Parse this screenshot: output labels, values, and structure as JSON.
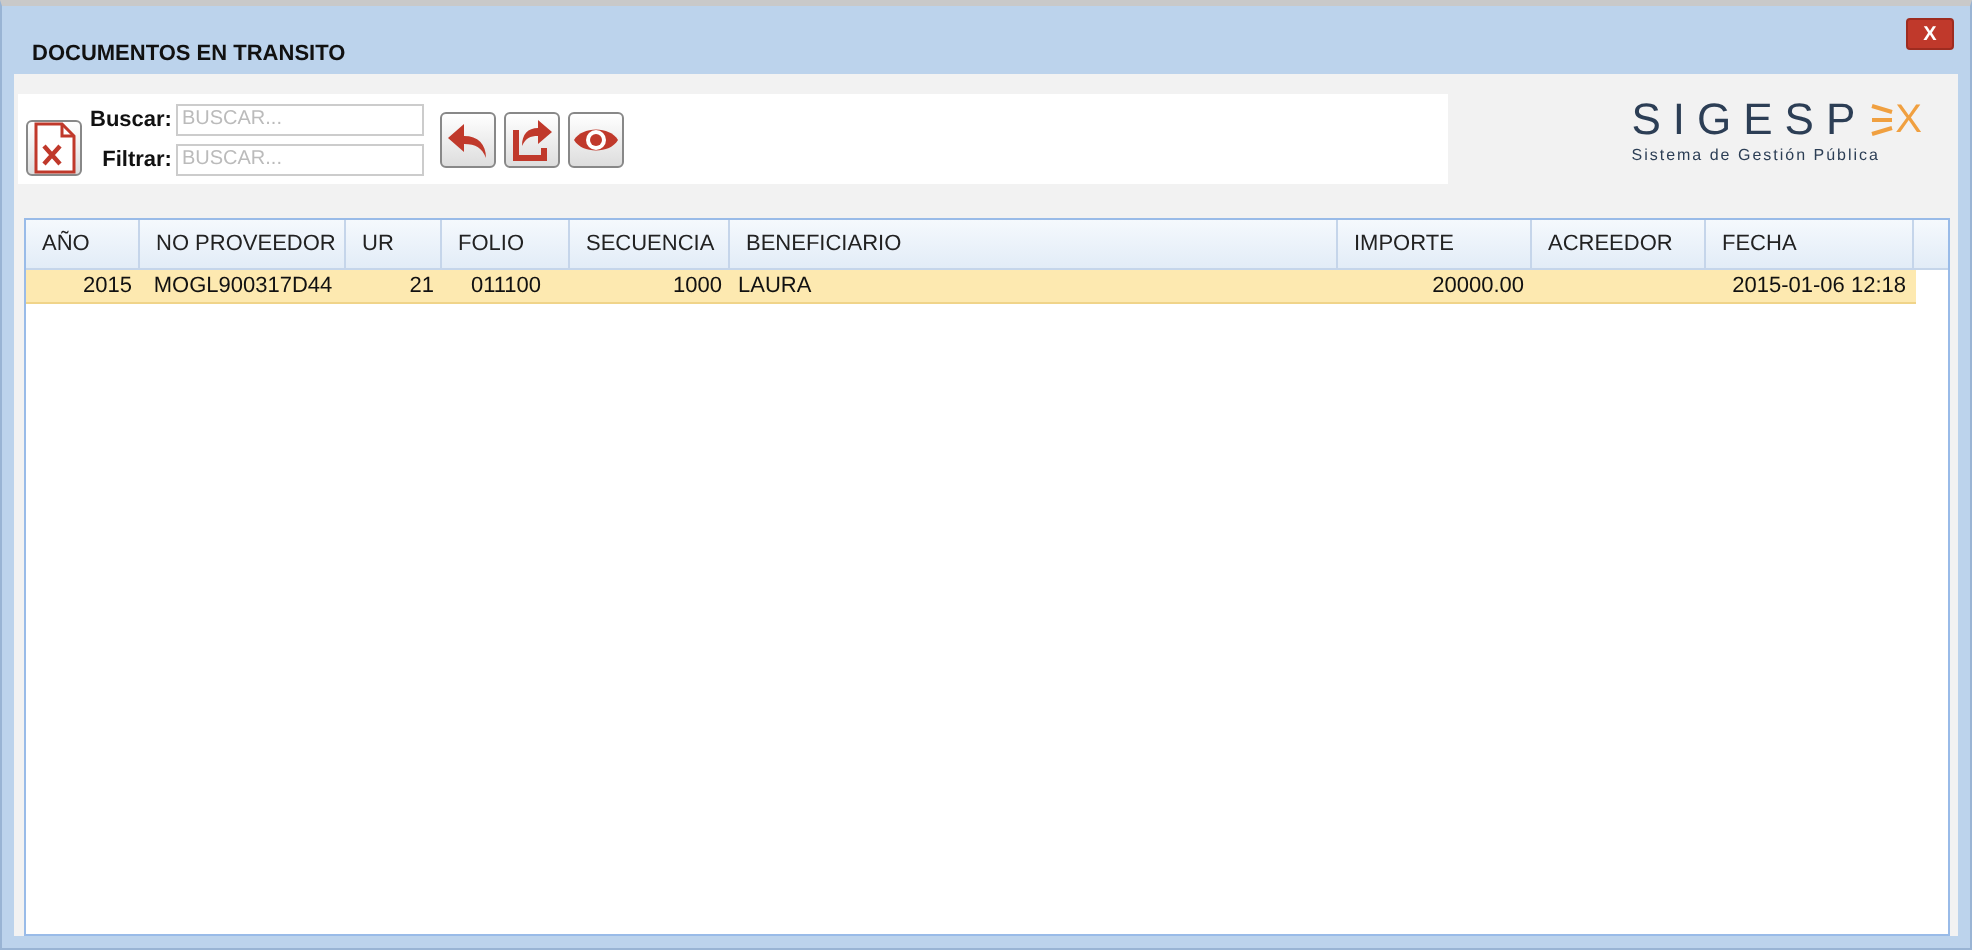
{
  "window": {
    "title": "DOCUMENTOS EN TRANSITO",
    "close_label": "X"
  },
  "toolbar": {
    "search": {
      "label": "Buscar:",
      "placeholder": "BUSCAR..."
    },
    "filter": {
      "label": "Filtrar:",
      "placeholder": "BUSCAR..."
    }
  },
  "logo": {
    "name": "SIGESP",
    "suffix": "X",
    "tagline": "Sistema de Gestión Pública"
  },
  "table": {
    "columns": [
      "AÑO",
      "NO PROVEEDOR",
      "UR",
      "FOLIO",
      "SECUENCIA",
      "BENEFICIARIO",
      "IMPORTE",
      "ACREEDOR",
      "FECHA"
    ],
    "rows": [
      {
        "selected": true,
        "cells": [
          "2015",
          "MOGL900317D44",
          "21",
          "011100",
          "1000",
          "LAURA",
          "20000.00",
          "",
          "2015-01-06 12:18"
        ]
      }
    ]
  }
}
